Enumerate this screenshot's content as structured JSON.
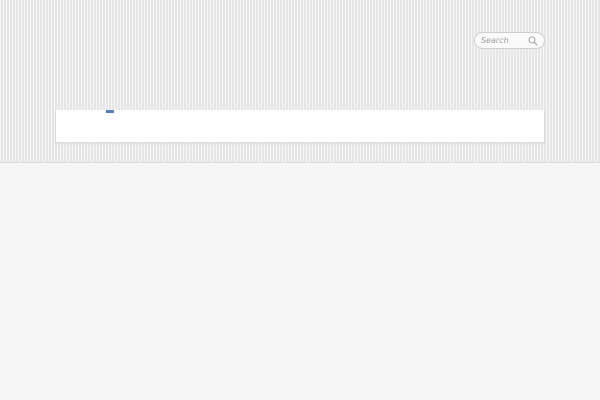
{
  "site": {
    "title": "",
    "tagline": ""
  },
  "search": {
    "placeholder": "Search"
  },
  "nav": {
    "items": [
      {
        "label": "",
        "active": false
      },
      {
        "label": "",
        "active": true
      },
      {
        "label": "",
        "active": false
      }
    ]
  },
  "main": {
    "title": "",
    "paragraphs": [
      "",
      "",
      "",
      "",
      "",
      "",
      ""
    ]
  },
  "sidebar": {
    "sections": [
      {
        "heading": "",
        "links": [
          "",
          "",
          ""
        ]
      },
      {
        "heading": "",
        "links": [
          "",
          "",
          ""
        ]
      },
      {
        "heading": "",
        "links": [
          ""
        ]
      }
    ]
  },
  "colors": {
    "accent": "#5a7fb5",
    "link_active": "#4a7ab5"
  }
}
